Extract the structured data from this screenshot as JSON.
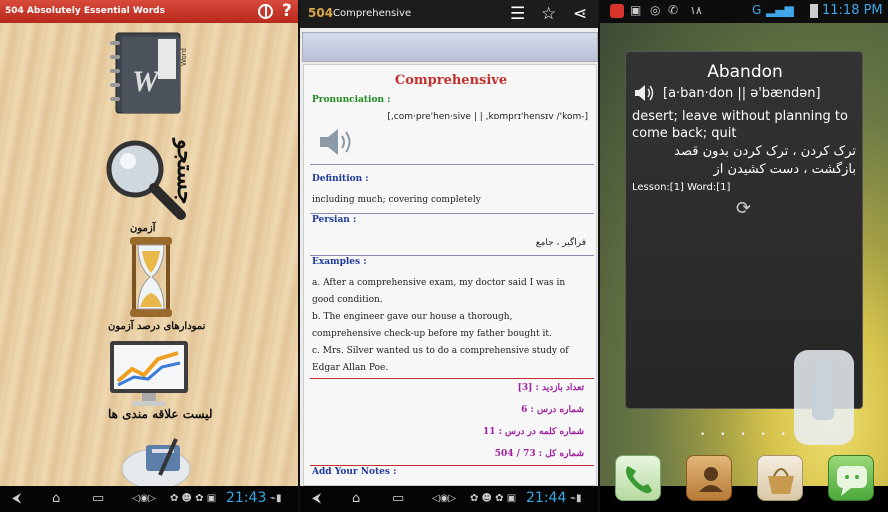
{
  "panel1": {
    "title": "504 Absolutely Essential Words",
    "help": "?",
    "book_text": "W",
    "book_label": "Word",
    "menu": {
      "search": "جستجو",
      "quiz": "آزمون",
      "charts": "نمودارهای درصد آزمون",
      "favorites": "لیست علاقه مندی ها"
    },
    "clock": "21:43"
  },
  "panel2": {
    "logo": "504",
    "title": "Comprehensive",
    "word": "Comprehensive",
    "pron_label": "Pronunciation :",
    "pron": "[,com·pre'hen·sive | | ,kɒmprɪ'hensɪv /'kom-]",
    "def_label": "Definition :",
    "definition": "including much; covering completely",
    "persian_label": "Persian :",
    "persian": "فراگیر ، جامع",
    "examples_label": "Examples :",
    "examples": [
      "a. After a comprehensive exam, my doctor said I was in good condition.",
      "b. The engineer gave our house a thorough, comprehensive check-up before my father bought it.",
      "c. Mrs. Silver wanted us to do a comprehensive study of Edgar Allan Poe."
    ],
    "stats": [
      "تعداد بازدید : [3]",
      "شماره درس : 6",
      "شماره کلمه در درس : 11",
      "شماره کل : 73 / 504"
    ],
    "notes_label": "Add Your Notes :",
    "clock": "21:44"
  },
  "panel3": {
    "status_number": "۱۸",
    "status_signal": "G",
    "clock": "11:18 PM",
    "widget": {
      "word": "Abandon",
      "pron": "[a·ban·don || ə'bændən]",
      "english": "desert; leave without planning to come back; quit",
      "persian": "ترک کردن ، ترک کردن بدون قصد بازگشت ، دست کشیدن از",
      "lesson": "Lesson:[1] Word:[1]"
    }
  },
  "colors": {
    "title_red": "#c0302c",
    "label_green": "#1f8a1f",
    "label_blue": "#1f3a9a",
    "stats_purple": "#a020a0",
    "clock_blue": "#38a9e6"
  }
}
